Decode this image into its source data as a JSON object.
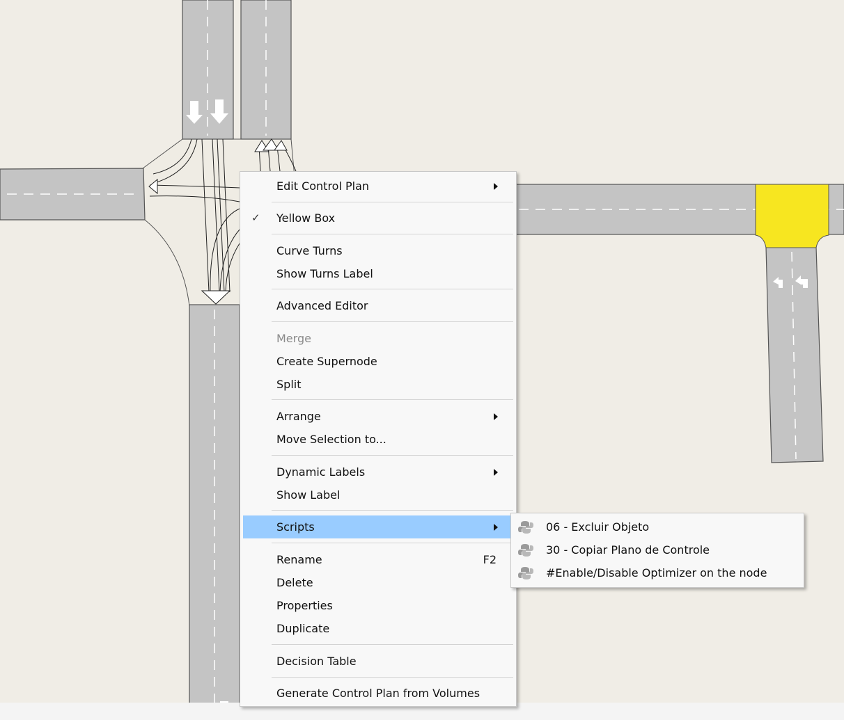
{
  "context_menu": {
    "items": [
      {
        "label": "Edit Control Plan",
        "submenu": true
      },
      {
        "label": "Yellow Box",
        "checked": true,
        "check_mark": "✓"
      },
      {
        "label": "Curve Turns"
      },
      {
        "label": "Show Turns Label"
      },
      {
        "label": "Advanced Editor"
      },
      {
        "label": "Merge",
        "disabled": true
      },
      {
        "label": "Create Supernode"
      },
      {
        "label": "Split"
      },
      {
        "label": "Arrange",
        "submenu": true
      },
      {
        "label": "Move Selection to..."
      },
      {
        "label": "Dynamic Labels",
        "submenu": true
      },
      {
        "label": "Show Label"
      },
      {
        "label": "Scripts",
        "submenu": true,
        "selected": true
      },
      {
        "label": "Rename",
        "shortcut": "F2"
      },
      {
        "label": "Delete"
      },
      {
        "label": "Properties"
      },
      {
        "label": "Duplicate"
      },
      {
        "label": "Decision Table"
      },
      {
        "label": "Generate Control Plan from Volumes"
      }
    ]
  },
  "scripts_submenu": {
    "items": [
      {
        "label": "06 - Excluir Objeto",
        "icon": "python-icon"
      },
      {
        "label": "30 - Copiar Plano de Controle",
        "icon": "python-icon"
      },
      {
        "label": "#Enable/Disable Optimizer on the node",
        "icon": "python-icon"
      }
    ]
  },
  "colors": {
    "background": "#f0ede6",
    "road": "#c4c4c4",
    "yellow_box": "#f7e620",
    "menu_highlight": "#99ccff"
  }
}
